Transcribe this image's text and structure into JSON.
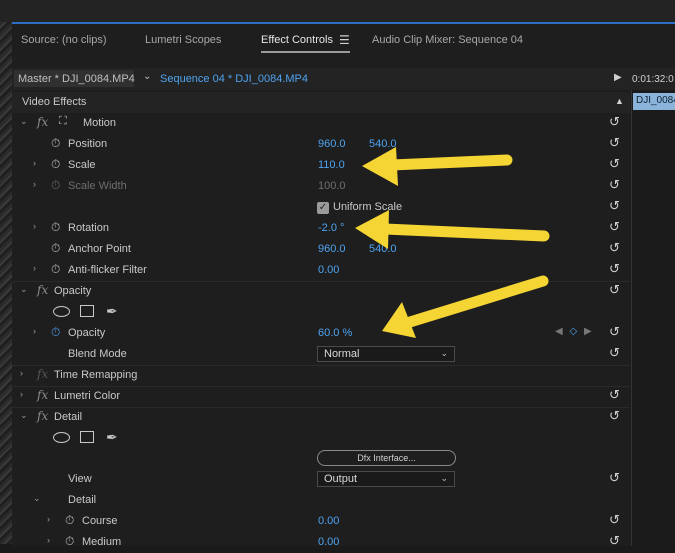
{
  "tabs": [
    {
      "label": "Source: (no clips)"
    },
    {
      "label": "Lumetri Scopes"
    },
    {
      "label": "Effect Controls"
    },
    {
      "label": "Audio Clip Mixer: Sequence 04"
    }
  ],
  "active_tab": "Effect Controls",
  "source_bar": {
    "master": "Master * DJI_0084.MP4",
    "sequence": "Sequence 04 * DJI_0084.MP4"
  },
  "timeline": {
    "timecode": "0:01:32:0",
    "clip_label": "DJI_0084"
  },
  "section_title": "Video Effects",
  "motion": {
    "title": "Motion",
    "position": {
      "label": "Position",
      "x": "960.0",
      "y": "540.0"
    },
    "scale": {
      "label": "Scale",
      "value": "110.0"
    },
    "scale_width": {
      "label": "Scale Width",
      "value": "100.0"
    },
    "uniform_scale": {
      "label": "Uniform Scale",
      "checked": true
    },
    "rotation": {
      "label": "Rotation",
      "value": "-2.0 °"
    },
    "anchor_point": {
      "label": "Anchor Point",
      "x": "960.0",
      "y": "540.0"
    },
    "anti_flicker": {
      "label": "Anti-flicker Filter",
      "value": "0.00"
    }
  },
  "opacity": {
    "title": "Opacity",
    "opacity": {
      "label": "Opacity",
      "value": "60.0 %"
    },
    "blend_mode": {
      "label": "Blend Mode",
      "value": "Normal"
    }
  },
  "time_remapping": {
    "title": "Time Remapping"
  },
  "lumetri_color": {
    "title": "Lumetri Color"
  },
  "detail": {
    "title": "Detail",
    "dfx_button": "Dfx Interface...",
    "view": {
      "label": "View",
      "value": "Output"
    },
    "group": {
      "label": "Detail"
    },
    "course": {
      "label": "Course",
      "value": "0.00"
    },
    "medium": {
      "label": "Medium",
      "value": "0.00"
    }
  },
  "colors": {
    "accent_blue": "#4fa3f0",
    "annotation_arrow": "#f5d533",
    "panel_bg": "#1e1e1e"
  }
}
